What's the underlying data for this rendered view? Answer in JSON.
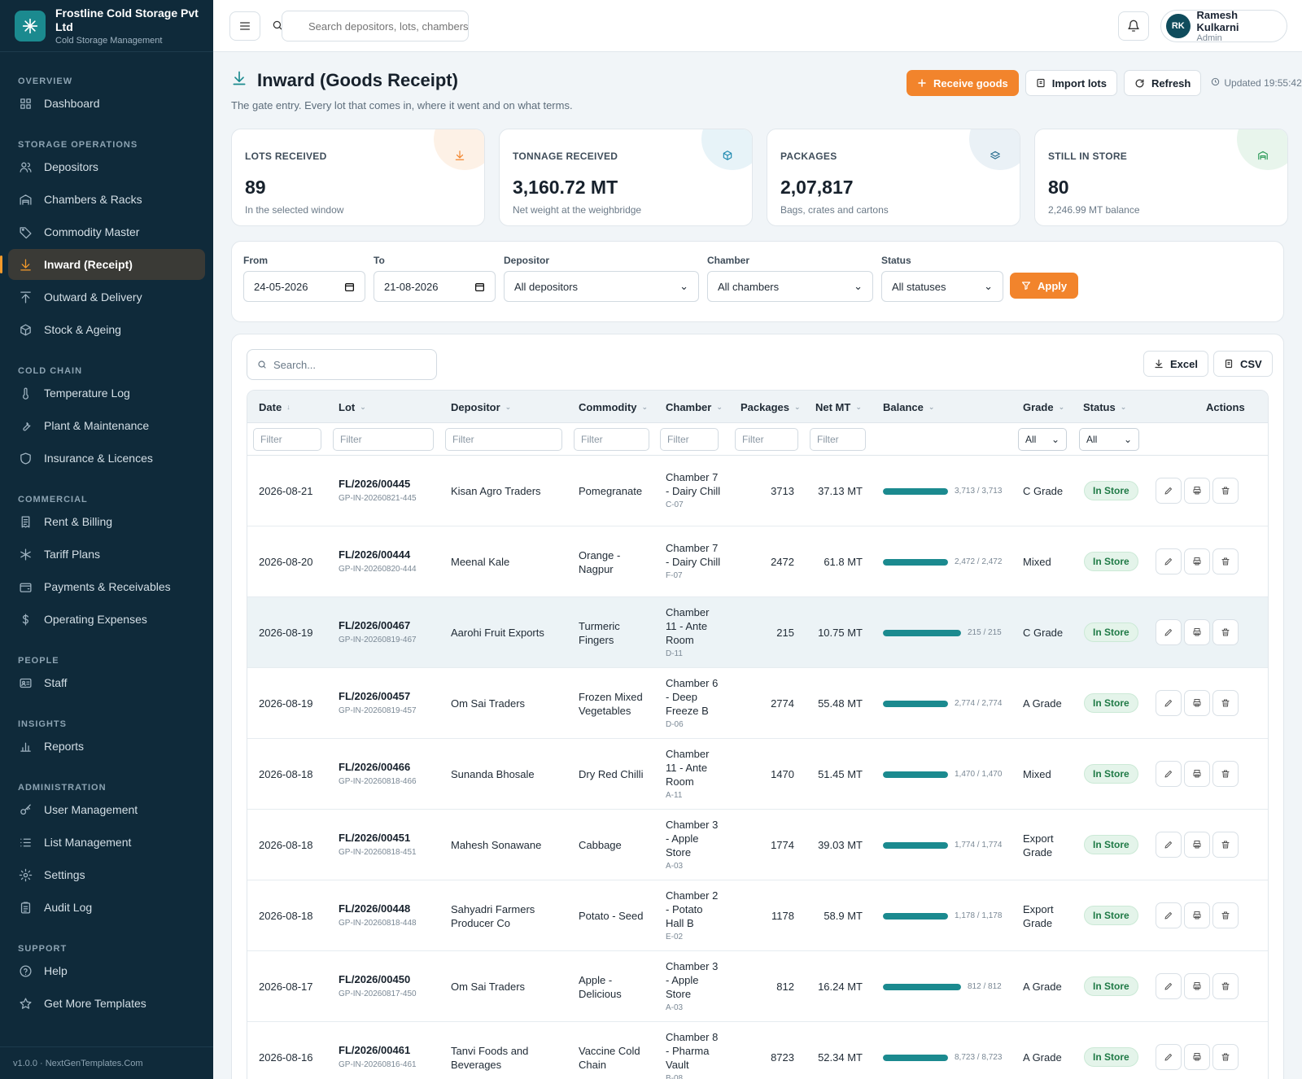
{
  "brand": {
    "name": "Frostline Cold Storage Pvt Ltd",
    "subtitle": "Cold Storage Management",
    "logo_icon": "snowflake-icon"
  },
  "nav": [
    {
      "section": "OVERVIEW",
      "items": [
        {
          "label": "Dashboard",
          "icon": "grid-icon"
        }
      ]
    },
    {
      "section": "STORAGE OPERATIONS",
      "items": [
        {
          "label": "Depositors",
          "icon": "users-icon"
        },
        {
          "label": "Chambers & Racks",
          "icon": "warehouse-icon"
        },
        {
          "label": "Commodity Master",
          "icon": "tag-icon"
        },
        {
          "label": "Inward (Receipt)",
          "icon": "download-icon",
          "active": true
        },
        {
          "label": "Outward & Delivery",
          "icon": "upload-icon"
        },
        {
          "label": "Stock & Ageing",
          "icon": "box-icon"
        }
      ]
    },
    {
      "section": "COLD CHAIN",
      "items": [
        {
          "label": "Temperature Log",
          "icon": "thermometer-icon"
        },
        {
          "label": "Plant & Maintenance",
          "icon": "wrench-icon"
        },
        {
          "label": "Insurance & Licences",
          "icon": "shield-icon"
        }
      ]
    },
    {
      "section": "COMMERCIAL",
      "items": [
        {
          "label": "Rent & Billing",
          "icon": "receipt-icon"
        },
        {
          "label": "Tariff Plans",
          "icon": "asterisk-icon"
        },
        {
          "label": "Payments & Receivables",
          "icon": "wallet-icon"
        },
        {
          "label": "Operating Expenses",
          "icon": "dollar-icon"
        }
      ]
    },
    {
      "section": "PEOPLE",
      "items": [
        {
          "label": "Staff",
          "icon": "id-card-icon"
        }
      ]
    },
    {
      "section": "INSIGHTS",
      "items": [
        {
          "label": "Reports",
          "icon": "bar-chart-icon"
        }
      ]
    },
    {
      "section": "ADMINISTRATION",
      "items": [
        {
          "label": "User Management",
          "icon": "key-icon"
        },
        {
          "label": "List Management",
          "icon": "list-icon"
        },
        {
          "label": "Settings",
          "icon": "gear-icon"
        },
        {
          "label": "Audit Log",
          "icon": "clipboard-icon"
        }
      ]
    },
    {
      "section": "SUPPORT",
      "items": [
        {
          "label": "Help",
          "icon": "help-icon"
        },
        {
          "label": "Get More Templates",
          "icon": "star-icon"
        }
      ]
    }
  ],
  "footer": "v1.0.0 · NextGenTemplates.Com",
  "topbar": {
    "search_placeholder": "Search depositors, lots, chambers",
    "user": {
      "initials": "RK",
      "name": "Ramesh Kulkarni",
      "role": "Admin"
    }
  },
  "page": {
    "title": "Inward (Goods Receipt)",
    "subtitle": "The gate entry. Every lot that comes in, where it went and on what terms.",
    "actions": {
      "receive": "Receive goods",
      "import": "Import lots",
      "refresh": "Refresh"
    },
    "updated": "Updated 19:55:42"
  },
  "stats": [
    {
      "label": "LOTS RECEIVED",
      "value": "89",
      "note": "In the selected window",
      "color": "#f2842c",
      "bg": "#fdf1e6",
      "icon": "download-icon"
    },
    {
      "label": "TONNAGE RECEIVED",
      "value": "3,160.72 MT",
      "note": "Net weight at the weighbridge",
      "color": "#1f8ab0",
      "bg": "#e7f3f8",
      "icon": "cube-icon"
    },
    {
      "label": "PACKAGES",
      "value": "2,07,817",
      "note": "Bags, crates and cartons",
      "color": "#2b6e8f",
      "bg": "#eaf1f6",
      "icon": "layers-icon"
    },
    {
      "label": "STILL IN STORE",
      "value": "80",
      "note": "2,246.99 MT balance",
      "color": "#2c9a58",
      "bg": "#e8f5ec",
      "icon": "warehouse-icon"
    }
  ],
  "filters": {
    "from": {
      "label": "From",
      "value": "24-05-2026"
    },
    "to": {
      "label": "To",
      "value": "21-08-2026"
    },
    "depositor": {
      "label": "Depositor",
      "value": "All depositors"
    },
    "chamber": {
      "label": "Chamber",
      "value": "All chambers"
    },
    "status": {
      "label": "Status",
      "value": "All statuses"
    },
    "apply": "Apply"
  },
  "table": {
    "search_placeholder": "Search...",
    "excel": "Excel",
    "csv": "CSV",
    "columns": {
      "date": "Date",
      "lot": "Lot",
      "depositor": "Depositor",
      "commodity": "Commodity",
      "chamber": "Chamber",
      "packages": "Packages",
      "net": "Net MT",
      "balance": "Balance",
      "grade": "Grade",
      "status": "Status",
      "actions": "Actions"
    },
    "filter_placeholder": "Filter",
    "select_all": "All",
    "rows": [
      {
        "date": "2026-08-21",
        "lot": "FL/2026/00445",
        "gp": "GP-IN-20260821-445",
        "depositor": "Kisan Agro Traders",
        "commodity": "Pomegranate",
        "chamber": "Chamber 7 - Dairy Chill",
        "code": "C-07",
        "packages": "3713",
        "net": "37.13 MT",
        "balance": "3,713 / 3,713",
        "fill": 1.0,
        "grade": "C Grade",
        "status": "In Store"
      },
      {
        "date": "2026-08-20",
        "lot": "FL/2026/00444",
        "gp": "GP-IN-20260820-444",
        "depositor": "Meenal Kale",
        "commodity": "Orange - Nagpur",
        "chamber": "Chamber 7 - Dairy Chill",
        "code": "F-07",
        "packages": "2472",
        "net": "61.8 MT",
        "balance": "2,472 / 2,472",
        "fill": 1.0,
        "grade": "Mixed",
        "status": "In Store"
      },
      {
        "date": "2026-08-19",
        "lot": "FL/2026/00467",
        "gp": "GP-IN-20260819-467",
        "depositor": "Aarohi Fruit Exports",
        "commodity": "Turmeric Fingers",
        "chamber": "Chamber 11 - Ante Room",
        "code": "D-11",
        "packages": "215",
        "net": "10.75 MT",
        "balance": "215 / 215",
        "fill": 1.0,
        "grade": "C Grade",
        "status": "In Store"
      },
      {
        "date": "2026-08-19",
        "lot": "FL/2026/00457",
        "gp": "GP-IN-20260819-457",
        "depositor": "Om Sai Traders",
        "commodity": "Frozen Mixed Vegetables",
        "chamber": "Chamber 6 - Deep Freeze B",
        "code": "D-06",
        "packages": "2774",
        "net": "55.48 MT",
        "balance": "2,774 / 2,774",
        "fill": 1.0,
        "grade": "A Grade",
        "status": "In Store"
      },
      {
        "date": "2026-08-18",
        "lot": "FL/2026/00466",
        "gp": "GP-IN-20260818-466",
        "depositor": "Sunanda Bhosale",
        "commodity": "Dry Red Chilli",
        "chamber": "Chamber 11 - Ante Room",
        "code": "A-11",
        "packages": "1470",
        "net": "51.45 MT",
        "balance": "1,470 / 1,470",
        "fill": 1.0,
        "grade": "Mixed",
        "status": "In Store"
      },
      {
        "date": "2026-08-18",
        "lot": "FL/2026/00451",
        "gp": "GP-IN-20260818-451",
        "depositor": "Mahesh Sonawane",
        "commodity": "Cabbage",
        "chamber": "Chamber 3 - Apple Store",
        "code": "A-03",
        "packages": "1774",
        "net": "39.03 MT",
        "balance": "1,774 / 1,774",
        "fill": 1.0,
        "grade": "Export Grade",
        "status": "In Store"
      },
      {
        "date": "2026-08-18",
        "lot": "FL/2026/00448",
        "gp": "GP-IN-20260818-448",
        "depositor": "Sahyadri Farmers Producer Co",
        "commodity": "Potato - Seed",
        "chamber": "Chamber 2 - Potato Hall B",
        "code": "E-02",
        "packages": "1178",
        "net": "58.9 MT",
        "balance": "1,178 / 1,178",
        "fill": 1.0,
        "grade": "Export Grade",
        "status": "In Store"
      },
      {
        "date": "2026-08-17",
        "lot": "FL/2026/00450",
        "gp": "GP-IN-20260817-450",
        "depositor": "Om Sai Traders",
        "commodity": "Apple - Delicious",
        "chamber": "Chamber 3 - Apple Store",
        "code": "A-03",
        "packages": "812",
        "net": "16.24 MT",
        "balance": "812 / 812",
        "fill": 1.0,
        "grade": "A Grade",
        "status": "In Store"
      },
      {
        "date": "2026-08-16",
        "lot": "FL/2026/00461",
        "gp": "GP-IN-20260816-461",
        "depositor": "Tanvi Foods and Beverages",
        "commodity": "Vaccine Cold Chain",
        "chamber": "Chamber 8 - Pharma Vault",
        "code": "B-08",
        "packages": "8723",
        "net": "52.34 MT",
        "balance": "8,723 / 8,723",
        "fill": 1.0,
        "grade": "A Grade",
        "status": "In Store"
      }
    ]
  }
}
